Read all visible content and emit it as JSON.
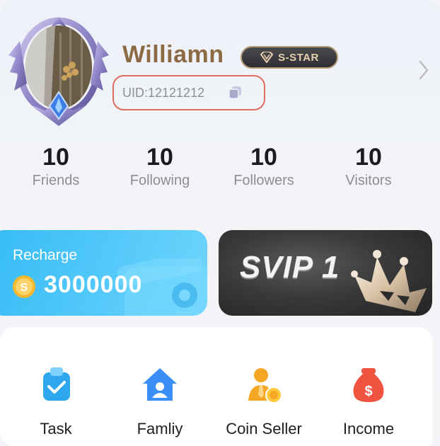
{
  "profile": {
    "username": "Williamn",
    "badge": "S-STAR",
    "uid": "UID:12121212"
  },
  "stats": [
    {
      "value": "10",
      "label": "Friends"
    },
    {
      "value": "10",
      "label": "Following"
    },
    {
      "value": "10",
      "label": "Followers"
    },
    {
      "value": "10",
      "label": "Visitors"
    }
  ],
  "recharge": {
    "title": "Recharge",
    "amount": "3000000"
  },
  "svip": {
    "label": "SVIP 1"
  },
  "features": [
    {
      "label": "Task",
      "icon": "task-clipboard-icon"
    },
    {
      "label": "Famliy",
      "icon": "family-house-icon"
    },
    {
      "label": "Coin Seller",
      "icon": "coin-seller-icon"
    },
    {
      "label": "Income",
      "icon": "money-bag-icon"
    }
  ],
  "colors": {
    "username": "#8c6a44",
    "uid_highlight": "#e06b60",
    "recharge_bg": "#36bbf5",
    "svip_bg": "#2f2f2f",
    "task_icon": "#2fa8f0",
    "family_icon": "#3b8ef5",
    "coin_seller_icon": "#f5a623",
    "income_icon": "#f0533f"
  }
}
